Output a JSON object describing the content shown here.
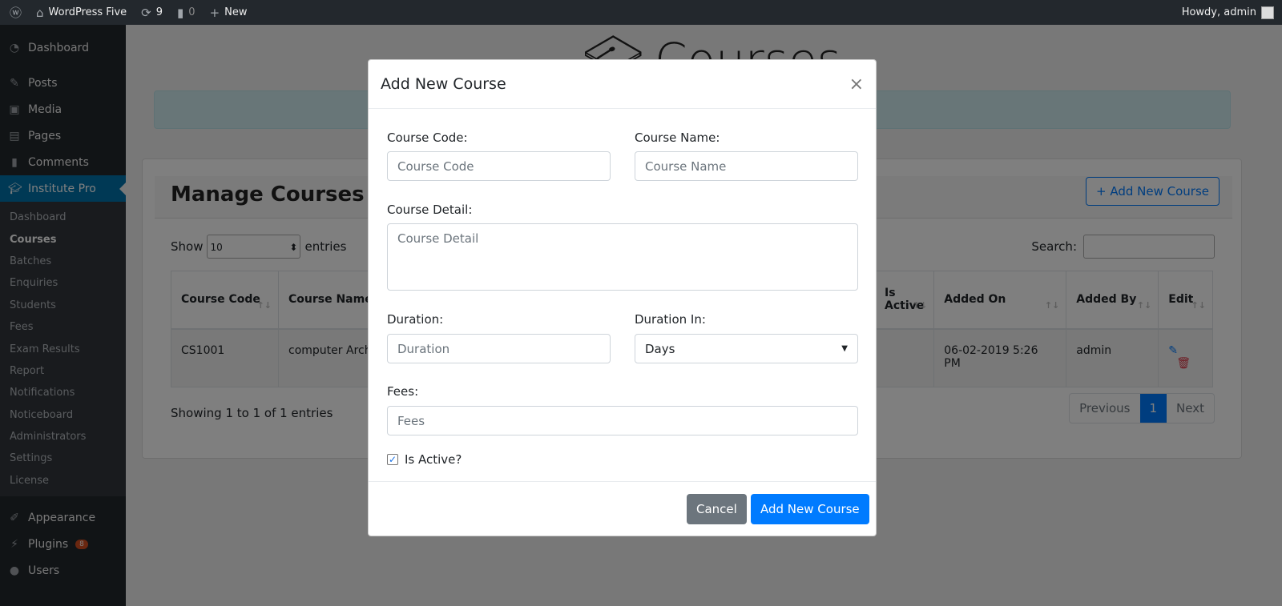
{
  "topbar": {
    "site": "WordPress Five",
    "updates": "9",
    "comments": "0",
    "new": "New",
    "greeting": "Howdy, admin"
  },
  "sidebar": {
    "items": [
      {
        "label": "Dashboard",
        "icon": "dashboard-icon"
      },
      {
        "label": "Posts",
        "icon": "pin-icon"
      },
      {
        "label": "Media",
        "icon": "media-icon"
      },
      {
        "label": "Pages",
        "icon": "pages-icon"
      },
      {
        "label": "Comments",
        "icon": "comment-icon"
      },
      {
        "label": "Institute Pro",
        "icon": "graduation-cap-icon"
      }
    ],
    "submenu": [
      "Dashboard",
      "Courses",
      "Batches",
      "Enquiries",
      "Students",
      "Fees",
      "Exam Results",
      "Report",
      "Notifications",
      "Noticeboard",
      "Administrators",
      "Settings",
      "License"
    ],
    "bottom": [
      {
        "label": "Appearance",
        "icon": "brush-icon"
      },
      {
        "label": "Plugins",
        "icon": "plugin-icon",
        "badge": "8"
      },
      {
        "label": "Users",
        "icon": "user-icon"
      }
    ]
  },
  "page": {
    "title": "Courses",
    "card_title": "Manage Courses",
    "add_button": "+ Add New Course",
    "show": "Show",
    "entries_value": "10",
    "entries": "entries",
    "search": "Search:",
    "columns": [
      "Course Code",
      "Course Name",
      "Is Active",
      "Added On",
      "Added By",
      "Edit"
    ],
    "rows": [
      {
        "code": "CS1001",
        "name": "computer Architecture",
        "added_on": "06-02-2019 5:26 PM",
        "added_by": "admin"
      }
    ],
    "info": "Showing 1 to 1 of 1 entries",
    "pager": {
      "prev": "Previous",
      "current": "1",
      "next": "Next"
    }
  },
  "modal": {
    "title": "Add New Course",
    "close": "×",
    "code_label": "Course Code:",
    "code_placeholder": "Course Code",
    "name_label": "Course Name:",
    "name_placeholder": "Course Name",
    "detail_label": "Course Detail:",
    "detail_placeholder": "Course Detail",
    "duration_label": "Duration:",
    "duration_placeholder": "Duration",
    "duration_in_label": "Duration In:",
    "duration_in_value": "Days",
    "fees_label": "Fees:",
    "fees_placeholder": "Fees",
    "active_label": "Is Active?",
    "active_checked": true,
    "cancel": "Cancel",
    "submit": "Add New Course"
  },
  "colors": {
    "primary": "#007bff",
    "wp_blue": "#0073aa",
    "admin_bar": "#23282d",
    "secondary": "#6c757d"
  }
}
